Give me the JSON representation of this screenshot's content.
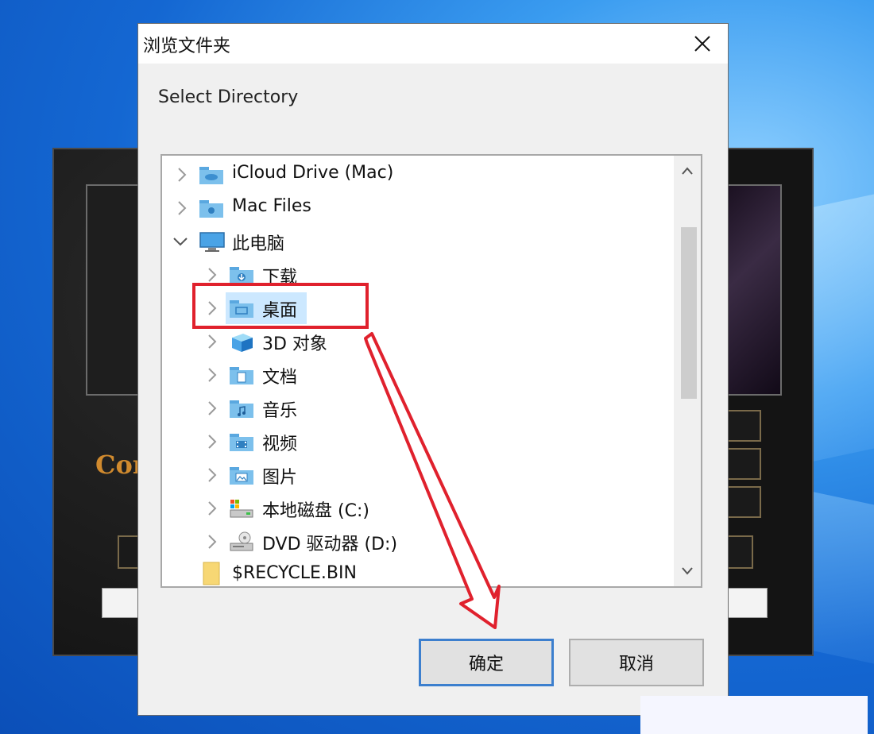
{
  "dialog": {
    "title": "浏览文件夹",
    "instruction": "Select Directory",
    "ok_label": "确定",
    "cancel_label": "取消"
  },
  "tree": {
    "items": [
      {
        "label": "iCloud Drive (Mac)",
        "icon": "icloud-folder-icon",
        "level": 0,
        "expanded": false
      },
      {
        "label": "Mac Files",
        "icon": "mac-folder-icon",
        "level": 0,
        "expanded": false
      },
      {
        "label": "此电脑",
        "icon": "computer-icon",
        "level": 0,
        "expanded": true
      },
      {
        "label": "下载",
        "icon": "downloads-folder-icon",
        "level": 1,
        "expanded": false
      },
      {
        "label": "桌面",
        "icon": "desktop-folder-icon",
        "level": 1,
        "expanded": false,
        "selected": true
      },
      {
        "label": "3D 对象",
        "icon": "3d-objects-icon",
        "level": 1,
        "expanded": false
      },
      {
        "label": "文档",
        "icon": "documents-folder-icon",
        "level": 1,
        "expanded": false
      },
      {
        "label": "音乐",
        "icon": "music-folder-icon",
        "level": 1,
        "expanded": false
      },
      {
        "label": "视频",
        "icon": "videos-folder-icon",
        "level": 1,
        "expanded": false
      },
      {
        "label": "图片",
        "icon": "pictures-folder-icon",
        "level": 1,
        "expanded": false
      },
      {
        "label": "本地磁盘 (C:)",
        "icon": "local-disk-icon",
        "level": 1,
        "expanded": false
      },
      {
        "label": "DVD 驱动器 (D:)",
        "icon": "dvd-drive-icon",
        "level": 1,
        "expanded": false
      },
      {
        "label": "$RECYCLE.BIN",
        "icon": "folder-icon",
        "level": 0,
        "expanded": null
      }
    ]
  },
  "background_app": {
    "title_fragment": "Cor"
  },
  "colors": {
    "selection": "#cce8ff",
    "annotation": "#e0212d",
    "ok_border": "#3c7fce"
  }
}
